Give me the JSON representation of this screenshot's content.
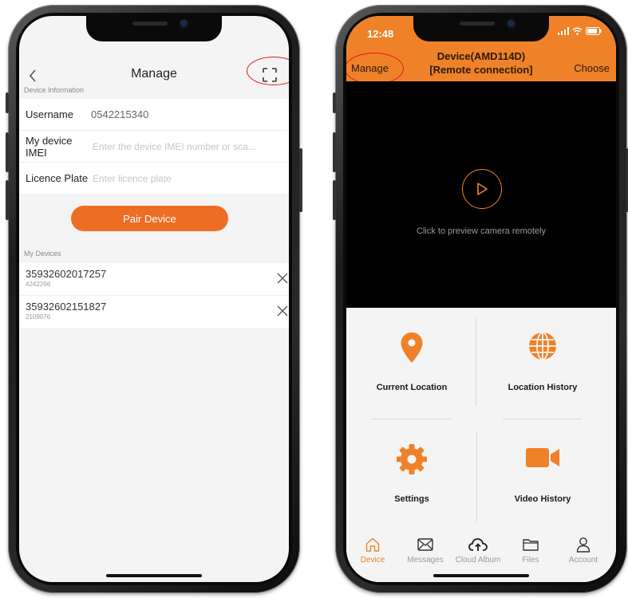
{
  "left_phone": {
    "header": {
      "title": "Manage"
    },
    "device_info": {
      "section_label": "Device Information",
      "username_label": "Username",
      "username_value": "0542215340",
      "imei_label": "My device IMEI",
      "imei_placeholder": "Enter the device IMEI number or sca...",
      "plate_label": "Licence Plate",
      "plate_placeholder": "Enter licence plate"
    },
    "pair_button": "Pair Device",
    "my_devices": {
      "section_label": "My Devices",
      "items": [
        {
          "imei": "35932602017257",
          "sub": "4242266"
        },
        {
          "imei": "35932602151827",
          "sub": "2109076"
        }
      ]
    }
  },
  "right_phone": {
    "status": {
      "time": "12:48"
    },
    "header": {
      "title_line1": "Device(AMD114D)",
      "title_line2": "[Remote connection]",
      "manage": "Manage",
      "choose": "Choose"
    },
    "preview_hint": "Click to preview camera remotely",
    "grid": {
      "current_location": "Current Location",
      "location_history": "Location History",
      "settings": "Settings",
      "video_history": "Video History"
    },
    "tabs": [
      {
        "label": "Device",
        "icon": "home-icon",
        "active": true
      },
      {
        "label": "Messages",
        "icon": "envelope-icon",
        "active": false
      },
      {
        "label": "Cloud Album",
        "icon": "cloud-upload-icon",
        "active": false
      },
      {
        "label": "Files",
        "icon": "folder-icon",
        "active": false
      },
      {
        "label": "Account",
        "icon": "user-icon",
        "active": false
      }
    ]
  },
  "colors": {
    "accent_orange": "#ef8228",
    "pair_button": "#ee6d25",
    "annotation_red": "#e0191a"
  }
}
